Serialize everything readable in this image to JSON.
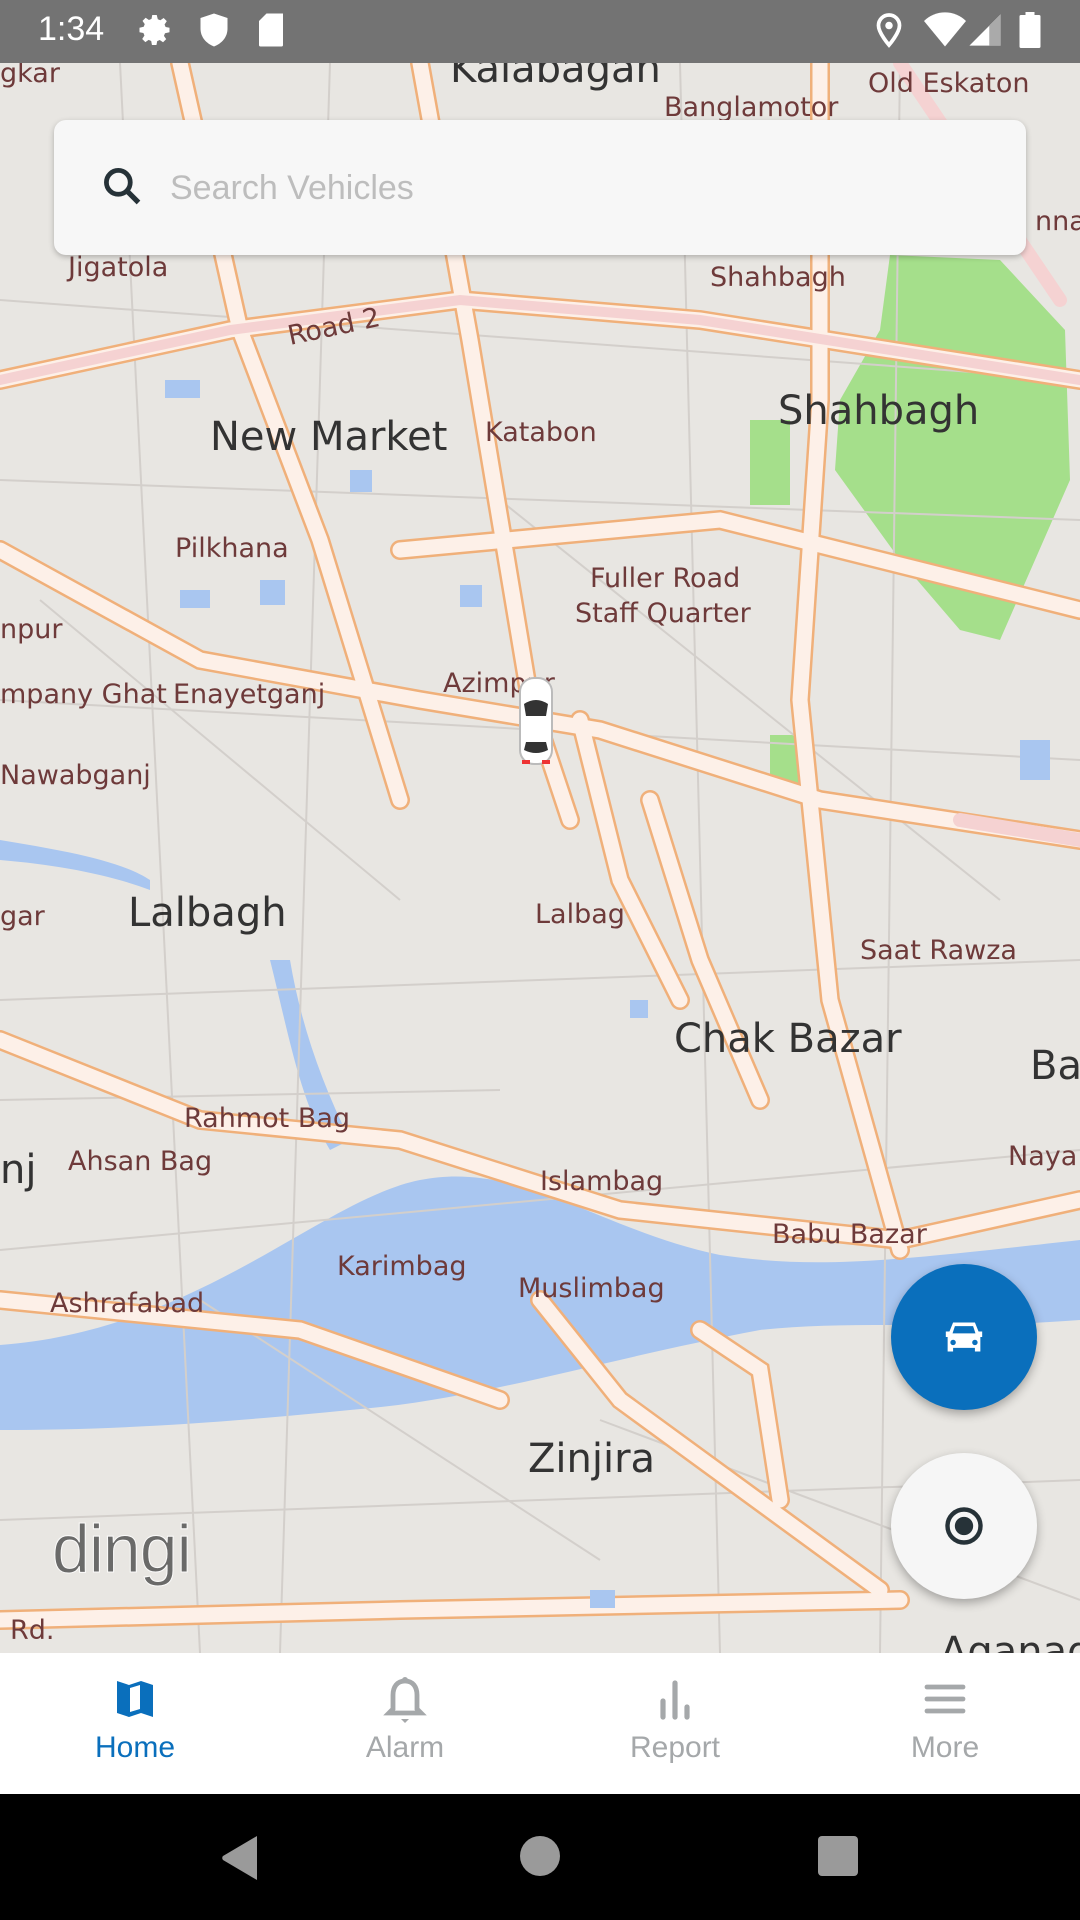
{
  "status_bar": {
    "time": "1:34",
    "left_icons": [
      "gear-icon",
      "shield-icon",
      "sd-card-icon"
    ],
    "right_icons": [
      "location-icon",
      "wifi-icon",
      "signal-icon",
      "battery-icon"
    ]
  },
  "search": {
    "placeholder": "Search Vehicles",
    "value": "",
    "icon": "search-icon"
  },
  "map": {
    "labels": [
      "Kalabagan",
      "Old Eskaton",
      "Banglamotor",
      "gkar",
      "nna",
      "Jigatola",
      "Road 2",
      "Shahbagh",
      "Shahbagh",
      "New Market",
      "Katabon",
      "Pilkhana",
      "Fuller Road",
      "Staff Quarter",
      "npur",
      "mpany Ghat",
      "Enayetganj",
      "Azimpur",
      "Nawabganj",
      "gar",
      "Lalbagh",
      "Lalbag",
      "Saat Rawza",
      "Chak Bazar",
      "Ba",
      "Rahmot Bag",
      "Ahsan Bag",
      "nj",
      "Naya",
      "Islambag",
      "Babu Bazar",
      "Karimbag",
      "Muslimbag",
      "Ashrafabad",
      "Zinjira",
      "Rd.",
      "Aganad"
    ],
    "logo": "dingi",
    "colors": {
      "land": "#e8e6e2",
      "road": "#fdf0e8",
      "road_casing": "#f0b07a",
      "water": "#a9c6f0",
      "park": "#a5df8b"
    }
  },
  "fabs": {
    "vehicles": {
      "icon": "car-icon",
      "color": "#0a6fbc"
    },
    "my_location": {
      "icon": "my-location-icon"
    }
  },
  "bottom_nav": {
    "active": "Home",
    "accent": "#0a6fbc",
    "items": [
      {
        "label": "Home",
        "icon": "map-icon"
      },
      {
        "label": "Alarm",
        "icon": "bell-icon"
      },
      {
        "label": "Report",
        "icon": "bar-chart-icon"
      },
      {
        "label": "More",
        "icon": "menu-icon"
      }
    ]
  }
}
